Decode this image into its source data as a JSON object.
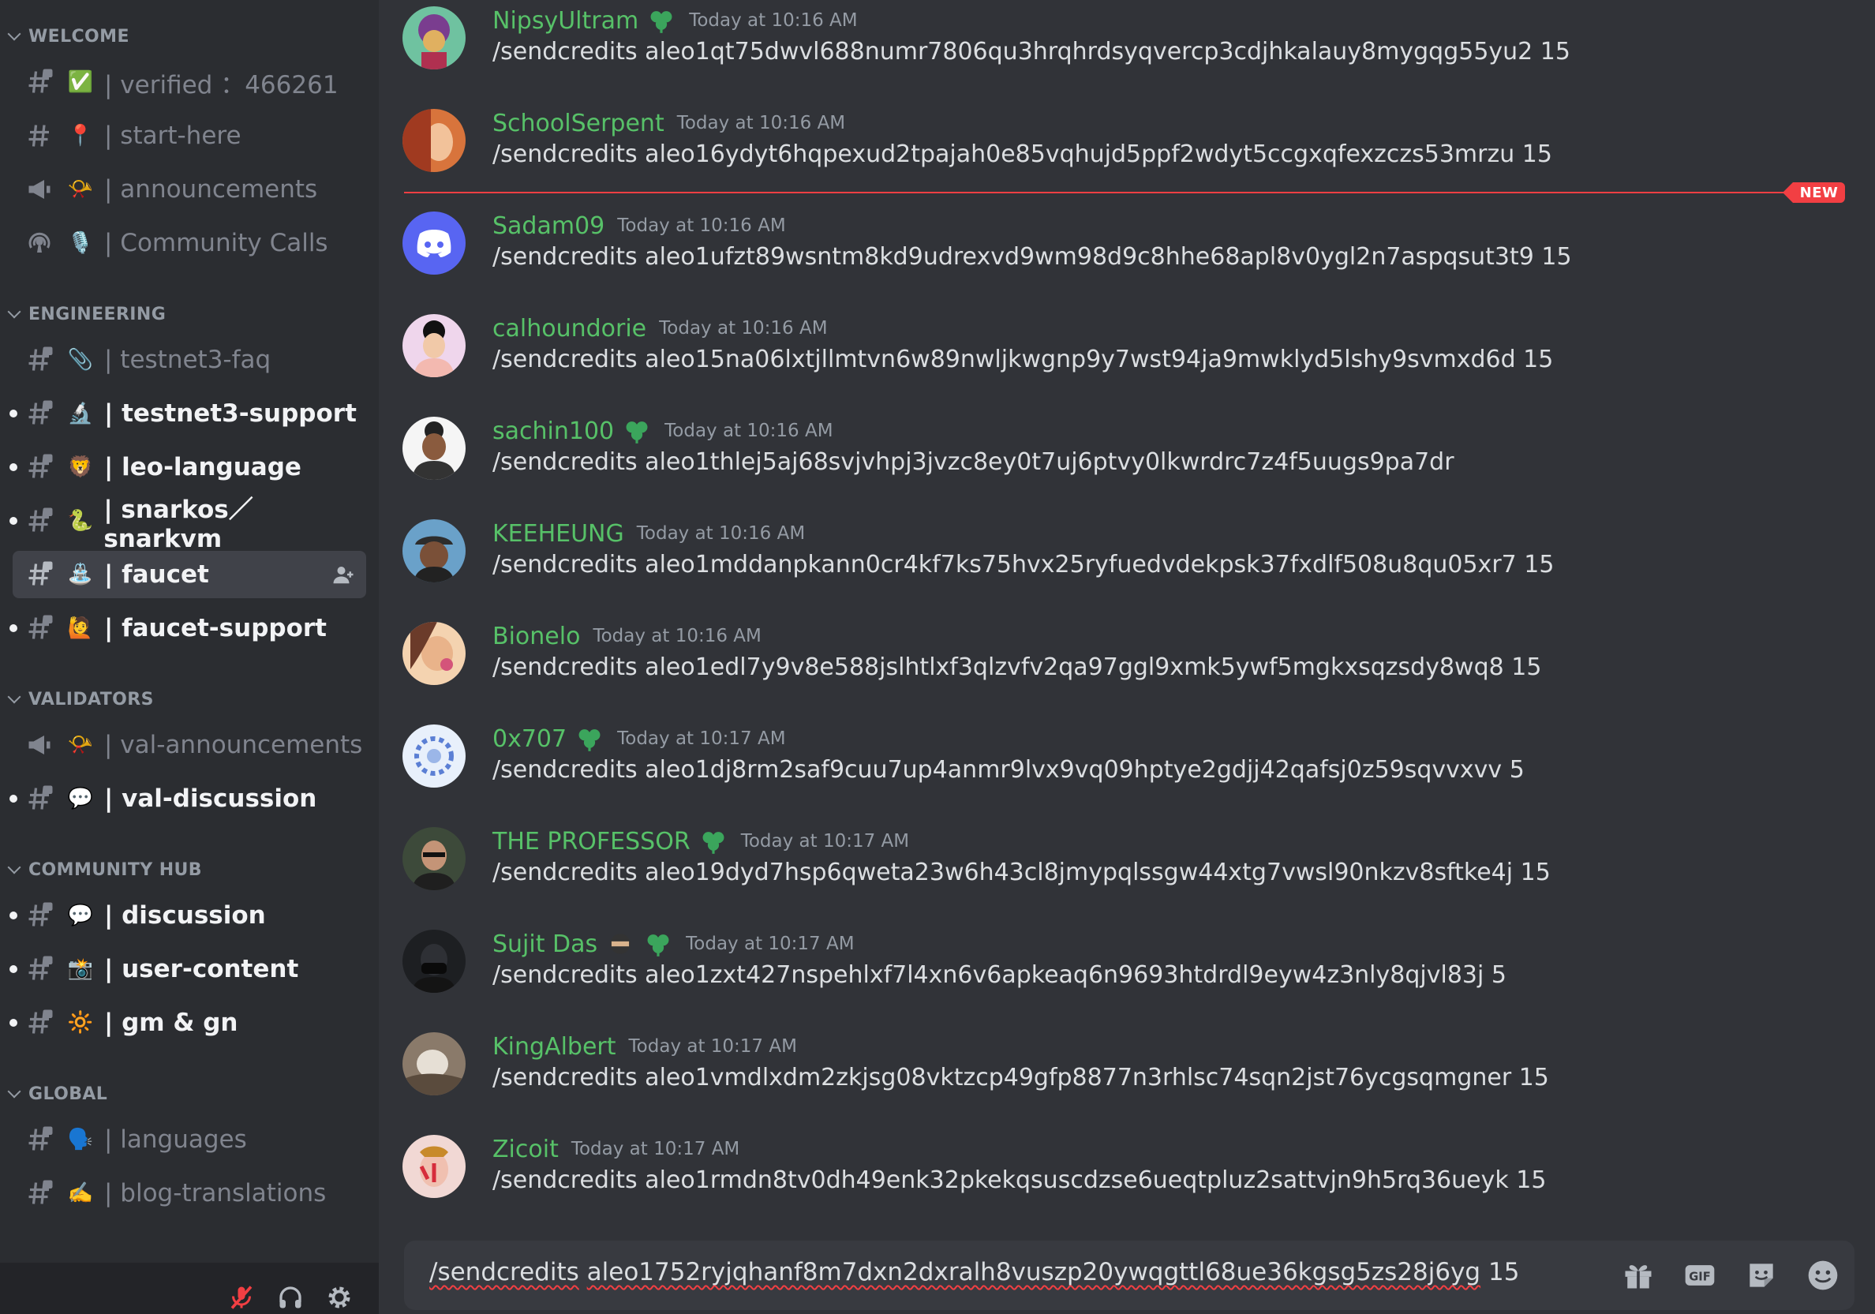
{
  "sidebar": {
    "categories": {
      "welcome": "WELCOME",
      "engineering": "ENGINEERING",
      "validators": "VALIDATORS",
      "community_hub": "COMMUNITY HUB",
      "global": "GLOBAL"
    },
    "channels": [
      {
        "emoji": "✅",
        "label": "| verified ：466261"
      },
      {
        "emoji": "📍",
        "label": "| start-here"
      },
      {
        "emoji": "📯",
        "label": "| announcements"
      },
      {
        "emoji": "🎙️",
        "label": "| Community Calls"
      },
      {
        "emoji": "📎",
        "label": "| testnet3-faq"
      },
      {
        "emoji": "🔬",
        "label": "| testnet3-support"
      },
      {
        "emoji": "🦁",
        "label": "| leo-language"
      },
      {
        "emoji": "🐍",
        "label": "| snarkos／snarkvm"
      },
      {
        "emoji": "⛲",
        "label": "| faucet"
      },
      {
        "emoji": "🙋",
        "label": "| faucet-support"
      },
      {
        "emoji": "📯",
        "label": "| val-announcements"
      },
      {
        "emoji": "💬",
        "label": "| val-discussion"
      },
      {
        "emoji": "💬",
        "label": "| discussion"
      },
      {
        "emoji": "📸",
        "label": "| user-content"
      },
      {
        "emoji": "🔆",
        "label": "| gm & gn"
      },
      {
        "emoji": "🗣️",
        "label": "| languages"
      },
      {
        "emoji": "✍️",
        "label": "| blog-translations"
      }
    ]
  },
  "messages": [
    {
      "user": "NipsyUltram",
      "time": "Today at 10:16 AM",
      "text": "/sendcredits aleo1qt75dwvl688numr7806qu3hrqhrdsyqvercp3cdjhkalauy8mygqg55yu2 15"
    },
    {
      "user": "SchoolSerpent",
      "time": "Today at 10:16 AM",
      "text": "/sendcredits aleo16ydyt6hqpexud2tpajah0e85vqhujd5ppf2wdyt5ccgxqfexzczs53mrzu 15"
    },
    {
      "user": "Sadam09",
      "time": "Today at 10:16 AM",
      "text": "/sendcredits aleo1ufzt89wsntm8kd9udrexvd9wm98d9c8hhe68apl8v0ygl2n7aspqsut3t9 15"
    },
    {
      "user": "calhoundorie",
      "time": "Today at 10:16 AM",
      "text": "/sendcredits aleo15na06lxtjllmtvn6w89nwljkwgnp9y7wst94ja9mwklyd5lshy9svmxd6d 15"
    },
    {
      "user": "sachin100",
      "time": "Today at 10:16 AM",
      "text": "/sendcredits aleo1thlej5aj68svjvhpj3jvzc8ey0t7uj6ptvy0lkwrdrc7z4f5uugs9pa7dr"
    },
    {
      "user": "KEEHEUNG",
      "time": "Today at 10:16 AM",
      "text": "/sendcredits aleo1mddanpkann0cr4kf7ks75hvx25ryfuedvdekpsk37fxdlf508u8qu05xr7 15"
    },
    {
      "user": "Bionelo",
      "time": "Today at 10:16 AM",
      "text": "/sendcredits aleo1edl7y9v8e588jslhtlxf3qlzvfv2qa97ggl9xmk5ywf5mgkxsqzsdy8wq8 15"
    },
    {
      "user": "0x707",
      "time": "Today at 10:17 AM",
      "text": "/sendcredits aleo1dj8rm2saf9cuu7up4anmr9lvx9vq09hptye2gdjj42qafsj0z59sqvvxvv 5"
    },
    {
      "user": "THE PROFESSOR",
      "time": "Today at 10:17 AM",
      "text": "/sendcredits aleo19dyd7hsp6qweta23w6h43cl8jmypqlssgw44xtg7vwsl90nkzv8sftke4j 15"
    },
    {
      "user": "Sujit Das",
      "time": "Today at 10:17 AM",
      "text": "/sendcredits aleo1zxt427nspehlxf7l4xn6v6apkeaq6n9693htdrdl9eyw4z3nly8qjvl83j 5"
    },
    {
      "user": "KingAlbert",
      "time": "Today at 10:17 AM",
      "text": "/sendcredits aleo1vmdlxdm2zkjsg08vktzcp49gfp8877n3rhlsc74sqn2jst76ycgsqmgner 15"
    },
    {
      "user": "Zicoit",
      "time": "Today at 10:17 AM",
      "text": "/sendcredits aleo1rmdn8tv0dh49enk32pkekqsuscdzse6ueqtpluz2sattvjn9h5rq36ueyk 15"
    }
  ],
  "divider": {
    "label": "NEW"
  },
  "composer": {
    "command": "/sendcredits",
    "address": "aleo1752ryjqhanf8m7dxn2dxralh8vuszp20ywqgttl68ue36kgsg5zs28j6yg",
    "amount": "15"
  },
  "colors": {
    "username": "#57c168",
    "divider": "#f23f43",
    "background": "#313338",
    "sidebar": "#2b2d31"
  }
}
